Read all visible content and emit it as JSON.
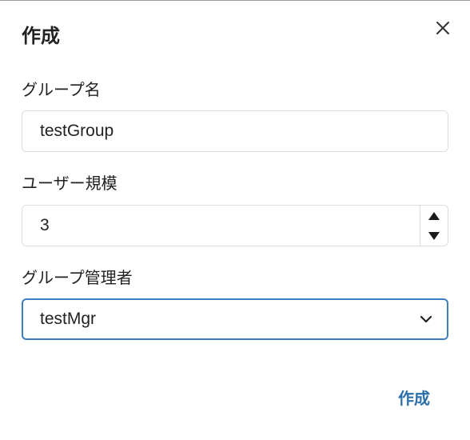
{
  "dialog": {
    "title": "作成"
  },
  "form": {
    "group_name": {
      "label": "グループ名",
      "value": "testGroup"
    },
    "user_scale": {
      "label": "ユーザー規模",
      "value": "3"
    },
    "group_manager": {
      "label": "グループ管理者",
      "selected": "testMgr"
    }
  },
  "footer": {
    "submit_label": "作成"
  },
  "colors": {
    "accent": "#2d6fa8",
    "focus_border": "#3d7fbf",
    "border": "#dadde1"
  },
  "icons": {
    "close": "close-icon",
    "increment": "arrow-up-icon",
    "decrement": "arrow-down-icon",
    "dropdown": "chevron-down-icon"
  }
}
